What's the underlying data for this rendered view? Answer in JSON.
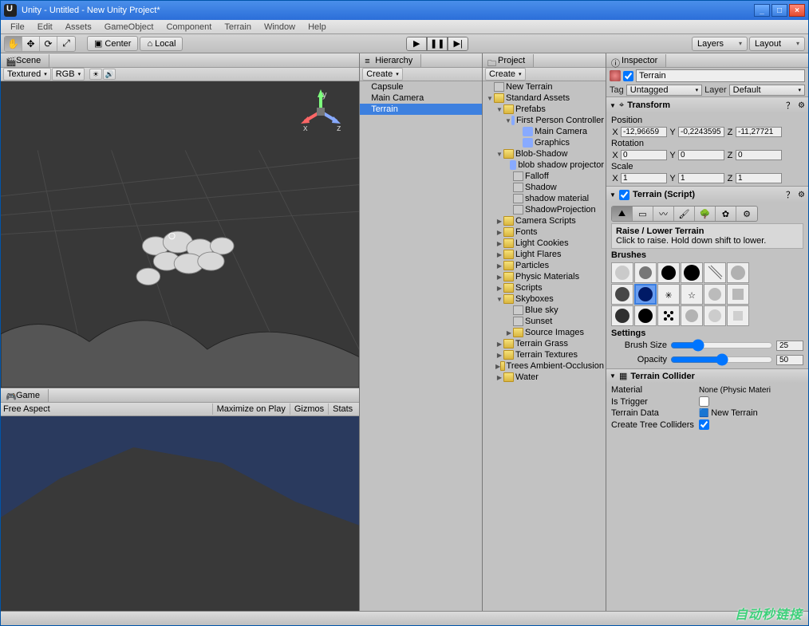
{
  "window": {
    "title": "Unity - Untitled - New Unity Project*"
  },
  "menu": {
    "items": [
      "File",
      "Edit",
      "Assets",
      "GameObject",
      "Component",
      "Terrain",
      "Window",
      "Help"
    ]
  },
  "toolbar": {
    "pivot": "Center",
    "space": "Local",
    "layers": "Layers",
    "layout": "Layout"
  },
  "scene": {
    "tab": "Scene",
    "shading": "Textured",
    "render": "RGB"
  },
  "game": {
    "tab": "Game",
    "aspect": "Free Aspect",
    "maximize": "Maximize on Play",
    "gizmos": "Gizmos",
    "stats": "Stats"
  },
  "hierarchy": {
    "tab": "Hierarchy",
    "create": "Create",
    "items": [
      "Capsule",
      "Main Camera",
      "Terrain"
    ],
    "selected": "Terrain"
  },
  "project": {
    "tab": "Project",
    "create": "Create",
    "tree": [
      {
        "d": 0,
        "f": "",
        "ic": "asset",
        "label": "New Terrain"
      },
      {
        "d": 0,
        "f": "▼",
        "ic": "folder",
        "label": "Standard Assets"
      },
      {
        "d": 1,
        "f": "▼",
        "ic": "folder",
        "label": "Prefabs"
      },
      {
        "d": 2,
        "f": "▼",
        "ic": "prefab",
        "label": "First Person Controller"
      },
      {
        "d": 3,
        "f": "",
        "ic": "prefab",
        "label": "Main Camera"
      },
      {
        "d": 3,
        "f": "",
        "ic": "prefab",
        "label": "Graphics"
      },
      {
        "d": 1,
        "f": "▼",
        "ic": "folder",
        "label": "Blob-Shadow"
      },
      {
        "d": 2,
        "f": "",
        "ic": "prefab",
        "label": "blob shadow projector"
      },
      {
        "d": 2,
        "f": "",
        "ic": "asset",
        "label": "Falloff"
      },
      {
        "d": 2,
        "f": "",
        "ic": "asset",
        "label": "Shadow"
      },
      {
        "d": 2,
        "f": "",
        "ic": "asset",
        "label": "shadow material"
      },
      {
        "d": 2,
        "f": "",
        "ic": "asset",
        "label": "ShadowProjection"
      },
      {
        "d": 1,
        "f": "▶",
        "ic": "folder",
        "label": "Camera Scripts"
      },
      {
        "d": 1,
        "f": "▶",
        "ic": "folder",
        "label": "Fonts"
      },
      {
        "d": 1,
        "f": "▶",
        "ic": "folder",
        "label": "Light Cookies"
      },
      {
        "d": 1,
        "f": "▶",
        "ic": "folder",
        "label": "Light Flares"
      },
      {
        "d": 1,
        "f": "▶",
        "ic": "folder",
        "label": "Particles"
      },
      {
        "d": 1,
        "f": "▶",
        "ic": "folder",
        "label": "Physic Materials"
      },
      {
        "d": 1,
        "f": "▶",
        "ic": "folder",
        "label": "Scripts"
      },
      {
        "d": 1,
        "f": "▼",
        "ic": "folder",
        "label": "Skyboxes"
      },
      {
        "d": 2,
        "f": "",
        "ic": "asset",
        "label": "Blue sky"
      },
      {
        "d": 2,
        "f": "",
        "ic": "asset",
        "label": "Sunset"
      },
      {
        "d": 2,
        "f": "▶",
        "ic": "folder",
        "label": "Source Images"
      },
      {
        "d": 1,
        "f": "▶",
        "ic": "folder",
        "label": "Terrain Grass"
      },
      {
        "d": 1,
        "f": "▶",
        "ic": "folder",
        "label": "Terrain Textures"
      },
      {
        "d": 1,
        "f": "▶",
        "ic": "folder",
        "label": "Trees Ambient-Occlusion"
      },
      {
        "d": 1,
        "f": "▶",
        "ic": "folder",
        "label": "Water"
      }
    ]
  },
  "inspector": {
    "tab": "Inspector",
    "name": "Terrain",
    "active": true,
    "tag_label": "Tag",
    "tag": "Untagged",
    "layer_label": "Layer",
    "layer": "Default",
    "transform": {
      "title": "Transform",
      "position_label": "Position",
      "rotation_label": "Rotation",
      "scale_label": "Scale",
      "position": {
        "x": "-12,96659",
        "y": "-0,2243595",
        "z": "-11,27721"
      },
      "rotation": {
        "x": "0",
        "y": "0",
        "z": "0"
      },
      "scale": {
        "x": "1",
        "y": "1",
        "z": "1"
      }
    },
    "terrain": {
      "title": "Terrain (Script)",
      "hint_title": "Raise / Lower Terrain",
      "hint_body": "Click to raise. Hold down shift to lower.",
      "brushes_label": "Brushes",
      "settings_label": "Settings",
      "brush_size_label": "Brush Size",
      "brush_size": "25",
      "opacity_label": "Opacity",
      "opacity": "50"
    },
    "collider": {
      "title": "Terrain Collider",
      "material_label": "Material",
      "material": "None (Physic Materi",
      "is_trigger_label": "Is Trigger",
      "is_trigger": false,
      "terrain_data_label": "Terrain Data",
      "terrain_data": "New Terrain",
      "create_tree_label": "Create Tree Colliders",
      "create_tree": true
    }
  },
  "watermark": "自动秒链接"
}
